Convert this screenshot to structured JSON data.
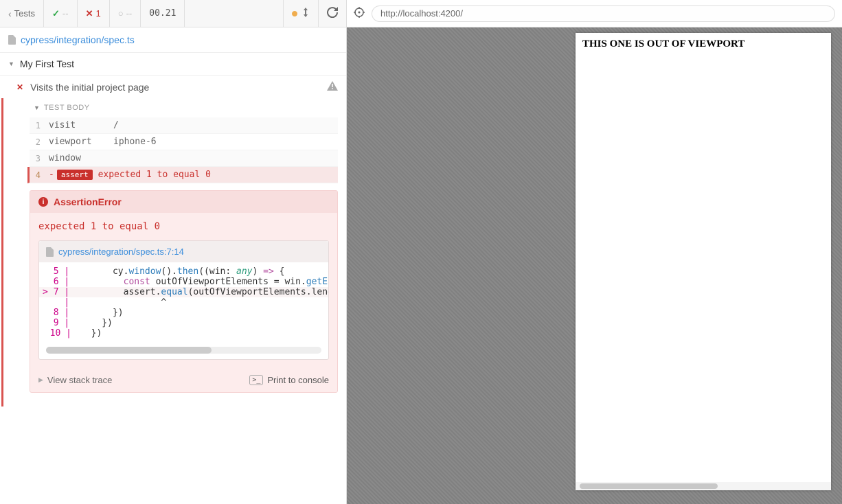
{
  "topbar": {
    "back_label": "Tests",
    "pass_count": "--",
    "fail_count": "1",
    "pending_count": "--",
    "time": "00.21"
  },
  "spec": {
    "path": "cypress/integration/spec.ts"
  },
  "suite": {
    "title": "My First Test"
  },
  "test": {
    "title": "Visits the initial project page",
    "body_label": "TEST BODY",
    "commands": [
      {
        "num": "1",
        "cmd": "visit",
        "args": "/"
      },
      {
        "num": "2",
        "cmd": "viewport",
        "args": "iphone-6"
      },
      {
        "num": "3",
        "cmd": "window",
        "args": ""
      }
    ],
    "assert": {
      "num": "4",
      "pill": "assert",
      "message": "expected 1 to equal 0"
    }
  },
  "error": {
    "name": "AssertionError",
    "message": "expected 1 to equal 0",
    "code_location": "cypress/integration/spec.ts:7:14",
    "code_lines": [
      {
        "ptr": " ",
        "ln": "5",
        "text": "      cy.window().then((win: any) => {"
      },
      {
        "ptr": " ",
        "ln": "6",
        "text": "        const outOfViewportElements = win.getElem"
      },
      {
        "ptr": ">",
        "ln": "7",
        "text": "        assert.equal(outOfViewportElements.length"
      },
      {
        "ptr": " ",
        "ln": "",
        "text": "               ^"
      },
      {
        "ptr": " ",
        "ln": "8",
        "text": "      })"
      },
      {
        "ptr": " ",
        "ln": "9",
        "text": "    })"
      },
      {
        "ptr": " ",
        "ln": "10",
        "text": "  })"
      }
    ],
    "trace_label": "View stack trace",
    "print_label": "Print to console"
  },
  "browser": {
    "url": "http://localhost:4200/"
  },
  "preview": {
    "heading": "THIS ONE IS OUT OF VIEWPORT"
  }
}
